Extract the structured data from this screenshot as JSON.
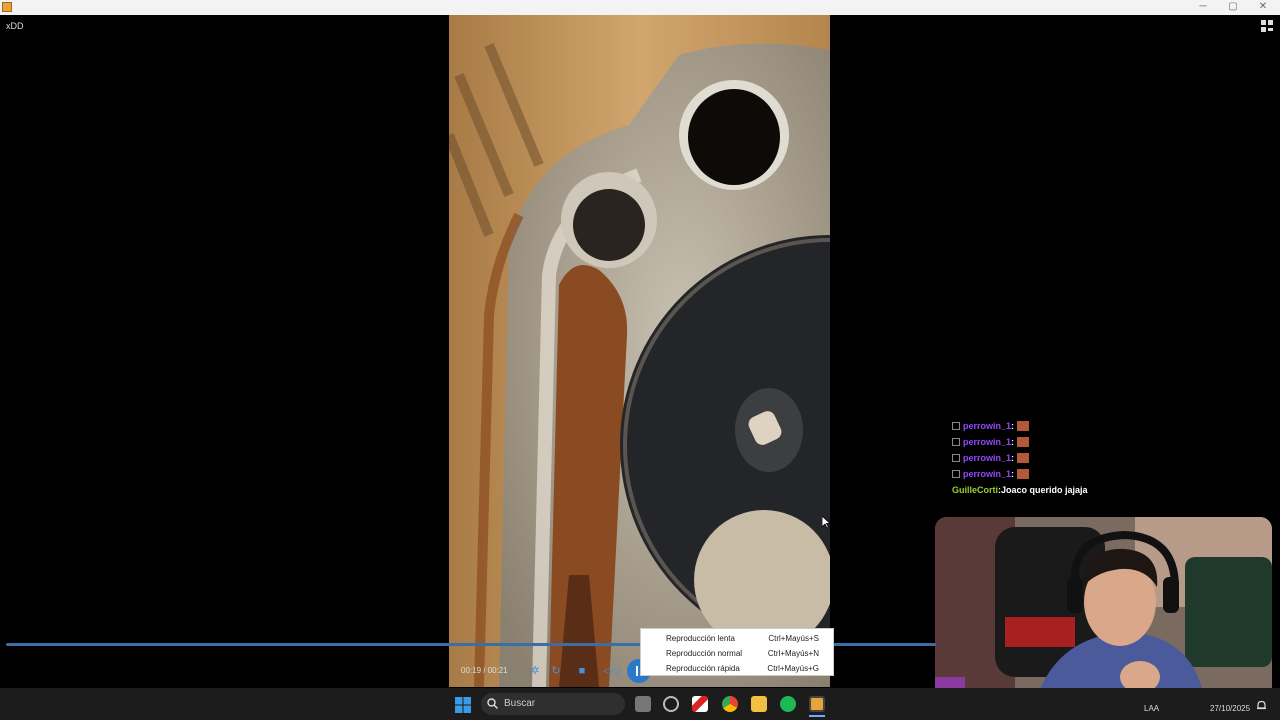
{
  "window": {
    "title": "xDD",
    "minimize_icon": "minimize-icon",
    "maximize_icon": "maximize-icon",
    "close_icon": "close-icon"
  },
  "chat": {
    "messages": [
      {
        "user": "perrowin_1",
        "sep": " :",
        "text": "",
        "user_color": "#9147ff"
      },
      {
        "user": "perrowin_1",
        "sep": " :",
        "text": "",
        "user_color": "#9147ff"
      },
      {
        "user": "perrowin_1",
        "sep": " :",
        "text": "",
        "user_color": "#9147ff"
      },
      {
        "user": "perrowin_1",
        "sep": " :",
        "text": "",
        "user_color": "#9147ff"
      },
      {
        "user": "GuilleCorti",
        "sep": " :",
        "text": " Joaco querido jajaja",
        "user_color": "#9acd32"
      }
    ]
  },
  "player": {
    "time": "00:19 / 00:21",
    "progress": 0.93,
    "accent": "#2b78c8"
  },
  "context_menu": {
    "items": [
      {
        "label": "Reproducción lenta",
        "shortcut": "Ctrl+Mayús+S"
      },
      {
        "label": "Reproducción normal",
        "shortcut": "Ctrl+Mayús+N"
      },
      {
        "label": "Reproducción rápida",
        "shortcut": "Ctrl+Mayús+G"
      }
    ]
  },
  "taskbar": {
    "search_label": "Buscar",
    "tray_lang": "LAA",
    "date": "27/10/2025"
  }
}
